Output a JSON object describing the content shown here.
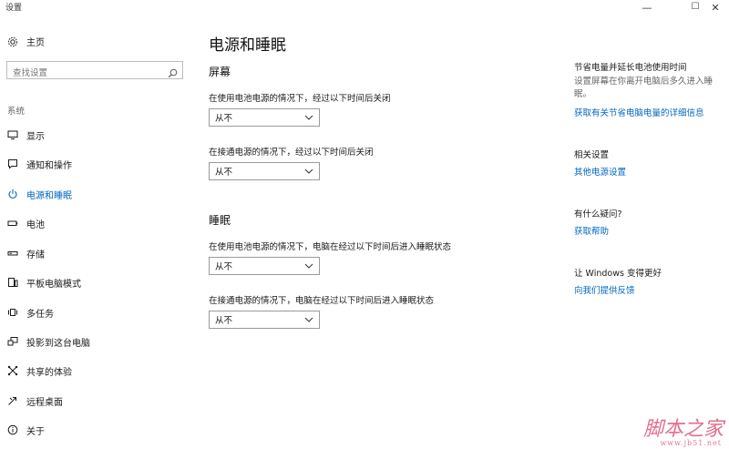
{
  "window": {
    "title": "设置",
    "minimize": "—",
    "maximize": "☐",
    "close": "✕"
  },
  "sidebar": {
    "home_label": "主页",
    "search_placeholder": "查找设置",
    "section_label": "系统",
    "items": [
      {
        "label": "显示",
        "icon": "monitor-icon"
      },
      {
        "label": "通知和操作",
        "icon": "message-icon"
      },
      {
        "label": "电源和睡眠",
        "icon": "power-icon",
        "active": true
      },
      {
        "label": "电池",
        "icon": "battery-icon"
      },
      {
        "label": "存储",
        "icon": "storage-icon"
      },
      {
        "label": "平板电脑模式",
        "icon": "tablet-icon"
      },
      {
        "label": "多任务",
        "icon": "multitask-icon"
      },
      {
        "label": "投影到这台电脑",
        "icon": "project-icon"
      },
      {
        "label": "共享的体验",
        "icon": "share-icon"
      },
      {
        "label": "远程桌面",
        "icon": "remote-icon"
      },
      {
        "label": "关于",
        "icon": "info-icon"
      }
    ]
  },
  "main": {
    "title": "电源和睡眠",
    "screen": {
      "title": "屏幕",
      "battery_label": "在使用电池电源的情况下，经过以下时间后关闭",
      "battery_value": "从不",
      "plugged_label": "在接通电源的情况下，经过以下时间后关闭",
      "plugged_value": "从不"
    },
    "sleep": {
      "title": "睡眠",
      "battery_label": "在使用电池电源的情况下，电脑在经过以下时间后进入睡眠状态",
      "battery_value": "从不",
      "plugged_label": "在接通电源的情况下，电脑在经过以下时间后进入睡眠状态",
      "plugged_value": "从不"
    }
  },
  "right": {
    "save": {
      "title": "节省电量并延长电池使用时间",
      "desc": "设置屏幕在你离开电脑后多久进入睡眠。",
      "link": "获取有关节省电脑电量的详细信息"
    },
    "related": {
      "title": "相关设置",
      "link": "其他电源设置"
    },
    "help": {
      "title": "有什么疑问?",
      "link": "获取帮助"
    },
    "feedback": {
      "title": "让 Windows 变得更好",
      "link": "向我们提供反馈"
    }
  },
  "watermark": {
    "main": "脚本之家",
    "sub": "www.jb51.net"
  },
  "colors": {
    "accent": "#0067c0",
    "text": "#1a1a1a",
    "muted": "#666666",
    "border": "#9a9a9a"
  }
}
